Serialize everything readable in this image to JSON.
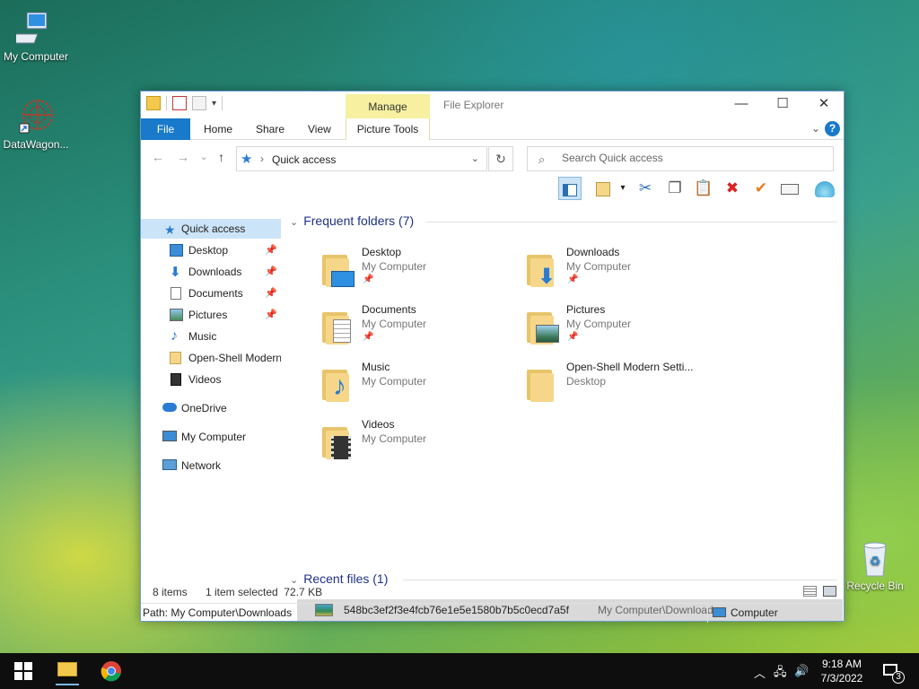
{
  "desktop": {
    "icons": [
      {
        "label": "My Computer",
        "icon": "computer-icon"
      },
      {
        "label": "DataWagon...",
        "icon": "datawagon-icon"
      },
      {
        "label": "Recycle Bin",
        "icon": "recycle-bin-icon"
      }
    ]
  },
  "window": {
    "title": "File Explorer",
    "manage_label": "Manage",
    "tabs": [
      "File",
      "Home",
      "Share",
      "View",
      "Picture Tools"
    ],
    "help_label": "?",
    "address": {
      "path": "Quick access"
    },
    "search": {
      "placeholder": "Search Quick access"
    },
    "nav": {
      "items": [
        {
          "label": "Quick access",
          "icon": "star-icon",
          "selected": true
        },
        {
          "label": "Desktop",
          "icon": "desktop-icon",
          "pinned": true
        },
        {
          "label": "Downloads",
          "icon": "download-arrow-icon",
          "pinned": true
        },
        {
          "label": "Documents",
          "icon": "document-icon",
          "pinned": true
        },
        {
          "label": "Pictures",
          "icon": "pictures-icon",
          "pinned": true
        },
        {
          "label": "Music",
          "icon": "music-note-icon"
        },
        {
          "label": "Open-Shell Modern",
          "icon": "folder-icon"
        },
        {
          "label": "Videos",
          "icon": "film-icon"
        },
        {
          "label": "OneDrive",
          "icon": "cloud-icon"
        },
        {
          "label": "My Computer",
          "icon": "computer-icon"
        },
        {
          "label": "Network",
          "icon": "network-icon"
        }
      ]
    },
    "frequent": {
      "header": "Frequent folders (7)",
      "folders": [
        {
          "name": "Desktop",
          "location": "My Computer",
          "pinned": true,
          "overlay": "desktop"
        },
        {
          "name": "Downloads",
          "location": "My Computer",
          "pinned": true,
          "overlay": "download"
        },
        {
          "name": "Documents",
          "location": "My Computer",
          "pinned": true,
          "overlay": "document"
        },
        {
          "name": "Pictures",
          "location": "My Computer",
          "pinned": true,
          "overlay": "picture"
        },
        {
          "name": "Music",
          "location": "My Computer",
          "pinned": false,
          "overlay": "music"
        },
        {
          "name": "Open-Shell Modern Setti...",
          "location": "Desktop",
          "pinned": false,
          "overlay": "none"
        },
        {
          "name": "Videos",
          "location": "My Computer",
          "pinned": false,
          "overlay": "film"
        }
      ]
    },
    "recent": {
      "header": "Recent files (1)",
      "files": [
        {
          "name": "548bc3ef2f3e4fcb76e1e5e1580b7b5c0ecd7a5f",
          "path": "My Computer\\Downloads"
        }
      ]
    },
    "status": {
      "items": "8 items",
      "selection": "1 item selected  72.7 KB"
    },
    "pathbar": {
      "path": "Path: My Computer\\Downloads",
      "zone": "Computer"
    }
  },
  "taskbar": {
    "clock_time": "9:18 AM",
    "clock_date": "7/3/2022",
    "notification_count": "3"
  },
  "colors": {
    "accent": "#1979ca",
    "selection": "#cce4f7",
    "manage": "#f6f0a0",
    "header_text": "#1e3287"
  }
}
